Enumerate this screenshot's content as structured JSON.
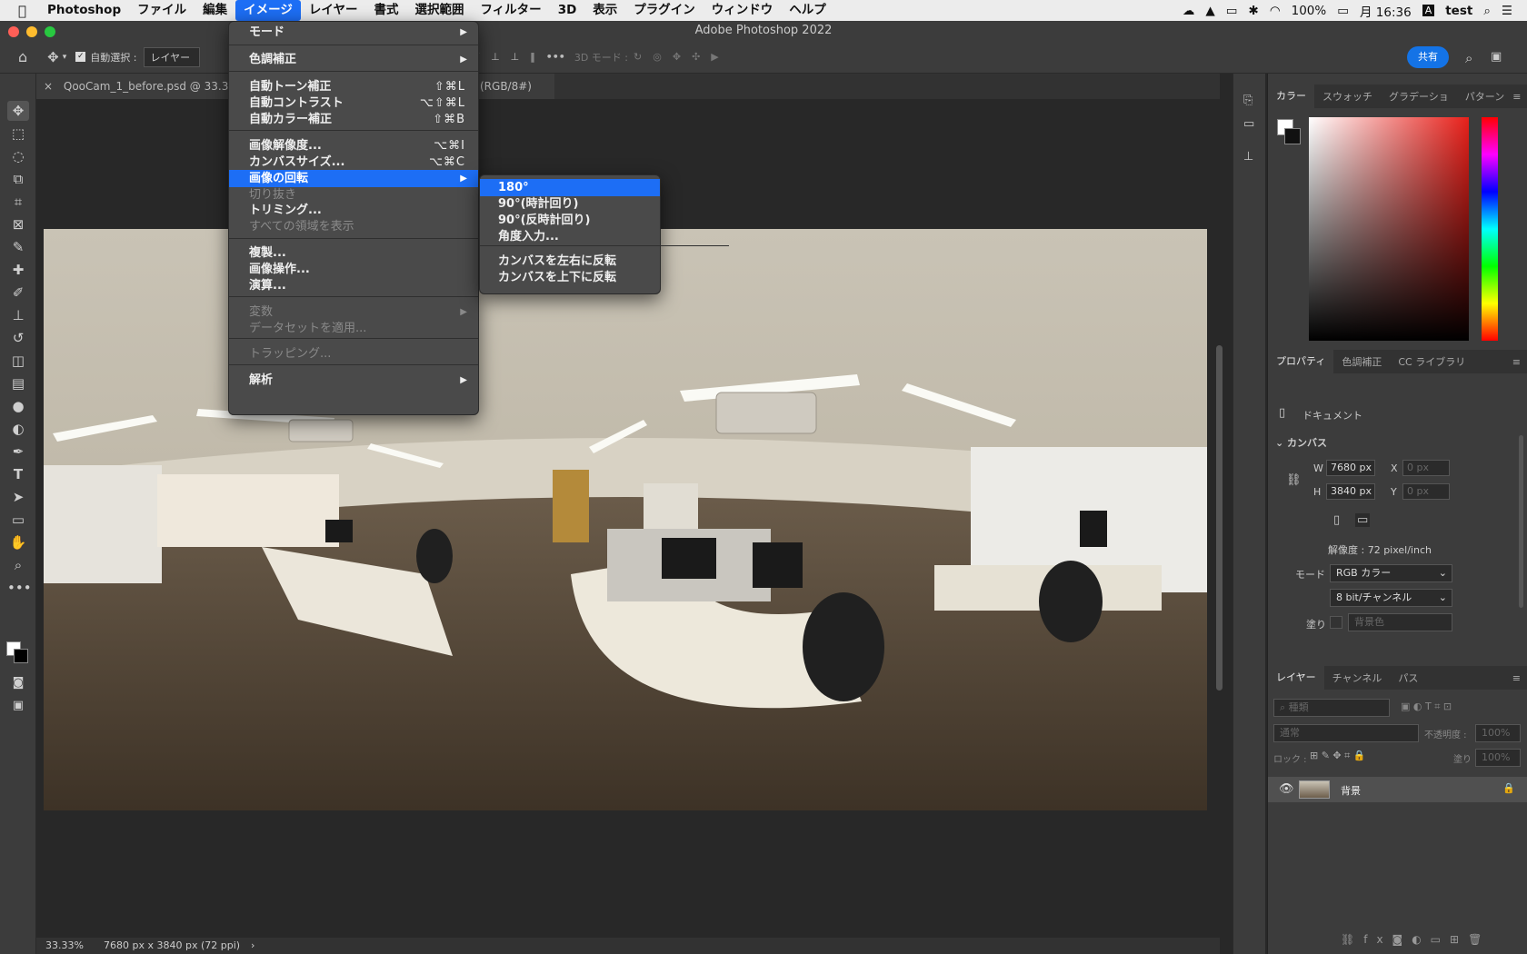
{
  "mac_menubar": {
    "app": "Photoshop",
    "items": [
      "ファイル",
      "編集",
      "イメージ",
      "レイヤー",
      "書式",
      "選択範囲",
      "フィルター",
      "3D",
      "表示",
      "プラグイン",
      "ウィンドウ",
      "ヘルプ"
    ],
    "active_item": "イメージ",
    "battery": "100%",
    "clock": "月 16:36",
    "user": "test"
  },
  "window": {
    "title": "Adobe Photoshop 2022"
  },
  "options_bar": {
    "auto_select_label": "自動選択 :",
    "auto_select_target": "レイヤー",
    "mode_3d_label": "3D モード :",
    "share_label": "共有"
  },
  "document_tab": {
    "name": "QooCam_1_before.psd @ 33.3%",
    "mode_suffix": "(RGB/8#)"
  },
  "image_menu": [
    {
      "label": "モード",
      "submenu": true
    },
    {
      "sep": true
    },
    {
      "label": "色調補正",
      "submenu": true
    },
    {
      "sep": true
    },
    {
      "label": "自動トーン補正",
      "shortcut": "⇧⌘L"
    },
    {
      "label": "自動コントラスト",
      "shortcut": "⌥⇧⌘L"
    },
    {
      "label": "自動カラー補正",
      "shortcut": "⇧⌘B"
    },
    {
      "sep": true
    },
    {
      "label": "画像解像度...",
      "shortcut": "⌥⌘I"
    },
    {
      "label": "カンバスサイズ...",
      "shortcut": "⌥⌘C"
    },
    {
      "label": "画像の回転",
      "submenu": true,
      "highlighted": true
    },
    {
      "label": "切り抜き",
      "disabled": true
    },
    {
      "label": "トリミング..."
    },
    {
      "label": "すべての領域を表示",
      "disabled": true
    },
    {
      "sep": true
    },
    {
      "label": "複製..."
    },
    {
      "label": "画像操作..."
    },
    {
      "label": "演算..."
    },
    {
      "sep": true
    },
    {
      "label": "変数",
      "submenu": true,
      "disabled": true
    },
    {
      "label": "データセットを適用...",
      "disabled": true
    },
    {
      "sep": true
    },
    {
      "label": "トラッピング...",
      "disabled": true
    },
    {
      "sep": true
    },
    {
      "label": "解析",
      "submenu": true
    }
  ],
  "rotate_submenu": [
    {
      "label": "180°",
      "highlighted": true
    },
    {
      "label": "90°(時計回り)"
    },
    {
      "label": "90°(反時計回り)"
    },
    {
      "label": "角度入力..."
    },
    {
      "sep": true
    },
    {
      "label": "カンバスを左右に反転"
    },
    {
      "label": "カンバスを上下に反転"
    }
  ],
  "color_panel": {
    "tabs": [
      "カラー",
      "スウォッチ",
      "グラデーショ",
      "パターン"
    ]
  },
  "properties_panel": {
    "tabs": [
      "プロパティ",
      "色調補正",
      "CC ライブラリ"
    ],
    "doc_label": "ドキュメント",
    "section": "カンバス",
    "w_label": "W",
    "w_value": "7680 px",
    "h_label": "H",
    "h_value": "3840 px",
    "x_label": "X",
    "x_placeholder": "0 px",
    "y_label": "Y",
    "y_placeholder": "0 px",
    "resolution": "解像度 : 72 pixel/inch",
    "mode_label": "モード",
    "mode_value": "RGB カラー",
    "depth_value": "8 bit/チャンネル",
    "fill_label": "塗り",
    "fill_value": "背景色"
  },
  "layers_panel": {
    "tabs": [
      "レイヤー",
      "チャンネル",
      "パス"
    ],
    "search_placeholder": "種類",
    "blend_mode": "通常",
    "opacity_label": "不透明度 :",
    "opacity_value": "100%",
    "lock_label": "ロック :",
    "fill_label": "塗り :",
    "fill_value": "100%",
    "layer_name": "背景"
  },
  "status_bar": {
    "zoom": "33.33%",
    "doc_info": "7680 px x 3840 px (72 ppi)"
  },
  "colors": {
    "accent": "#1d6ef5",
    "share": "#1473e6",
    "panel": "#3c3c3c",
    "canvas": "#282828"
  }
}
